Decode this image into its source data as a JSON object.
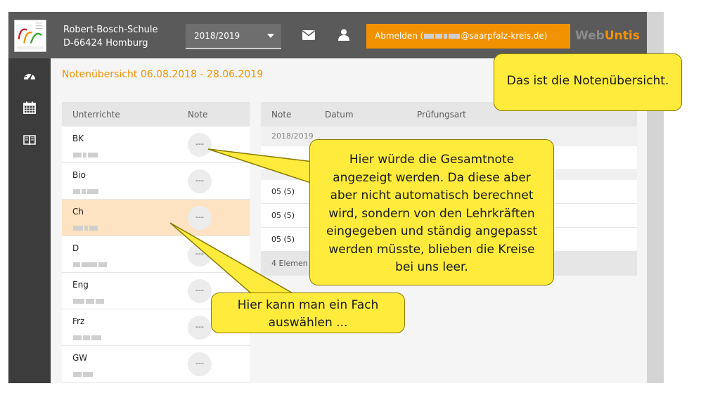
{
  "header": {
    "school_name": "Robert-Bosch-Schule",
    "school_address": "D-66424 Homburg",
    "school_year": "2018/2019",
    "logout_prefix": "Abmelden (",
    "logout_suffix": "@saarpfalz-kreis.de)",
    "brand_part1": "Web",
    "brand_part2": "Untis"
  },
  "content": {
    "title": "Notenübersicht 06.08.2018 - 28.06.2019"
  },
  "subjects_table": {
    "col_subject": "Unterrichte",
    "col_grade": "Note",
    "rows": [
      {
        "name": "BK",
        "grade": "---"
      },
      {
        "name": "Bio",
        "grade": "---"
      },
      {
        "name": "Ch",
        "grade": "---"
      },
      {
        "name": "D",
        "grade": "---"
      },
      {
        "name": "Eng",
        "grade": "---"
      },
      {
        "name": "Frz",
        "grade": "---"
      },
      {
        "name": "GW",
        "grade": "---"
      }
    ]
  },
  "grades_table": {
    "col_grade": "Note",
    "col_date": "Datum",
    "col_exam_type": "Prüfungsart",
    "section": "2018/2019",
    "rows": [
      {
        "grade": "05 (5)"
      },
      {
        "grade": "05 (5)"
      },
      {
        "grade": "05 (5)"
      }
    ],
    "footer": "4 Elemen"
  },
  "callouts": {
    "overview": "Das ist die Notenübersicht.",
    "total_grade": "Hier würde die Gesamtnote angezeigt werden. Da diese aber aber nicht automatisch berechnet wird, sondern von den Lehrkräften eingegeben und ständig angepasst werden müsste, blieben die Kreise bei uns leer.",
    "select_subject": "Hier kann man ein Fach auswählen ..."
  },
  "colors": {
    "accent": "#f39200",
    "topbar": "#5a5a5a",
    "sidebar": "#3c3c3c",
    "callout": "#ffeb3b",
    "selected_row": "#fde3c2"
  },
  "icons": [
    "dashboard-icon",
    "calendar-icon",
    "book-icon",
    "mail-icon",
    "user-icon",
    "chevron-down-icon"
  ]
}
